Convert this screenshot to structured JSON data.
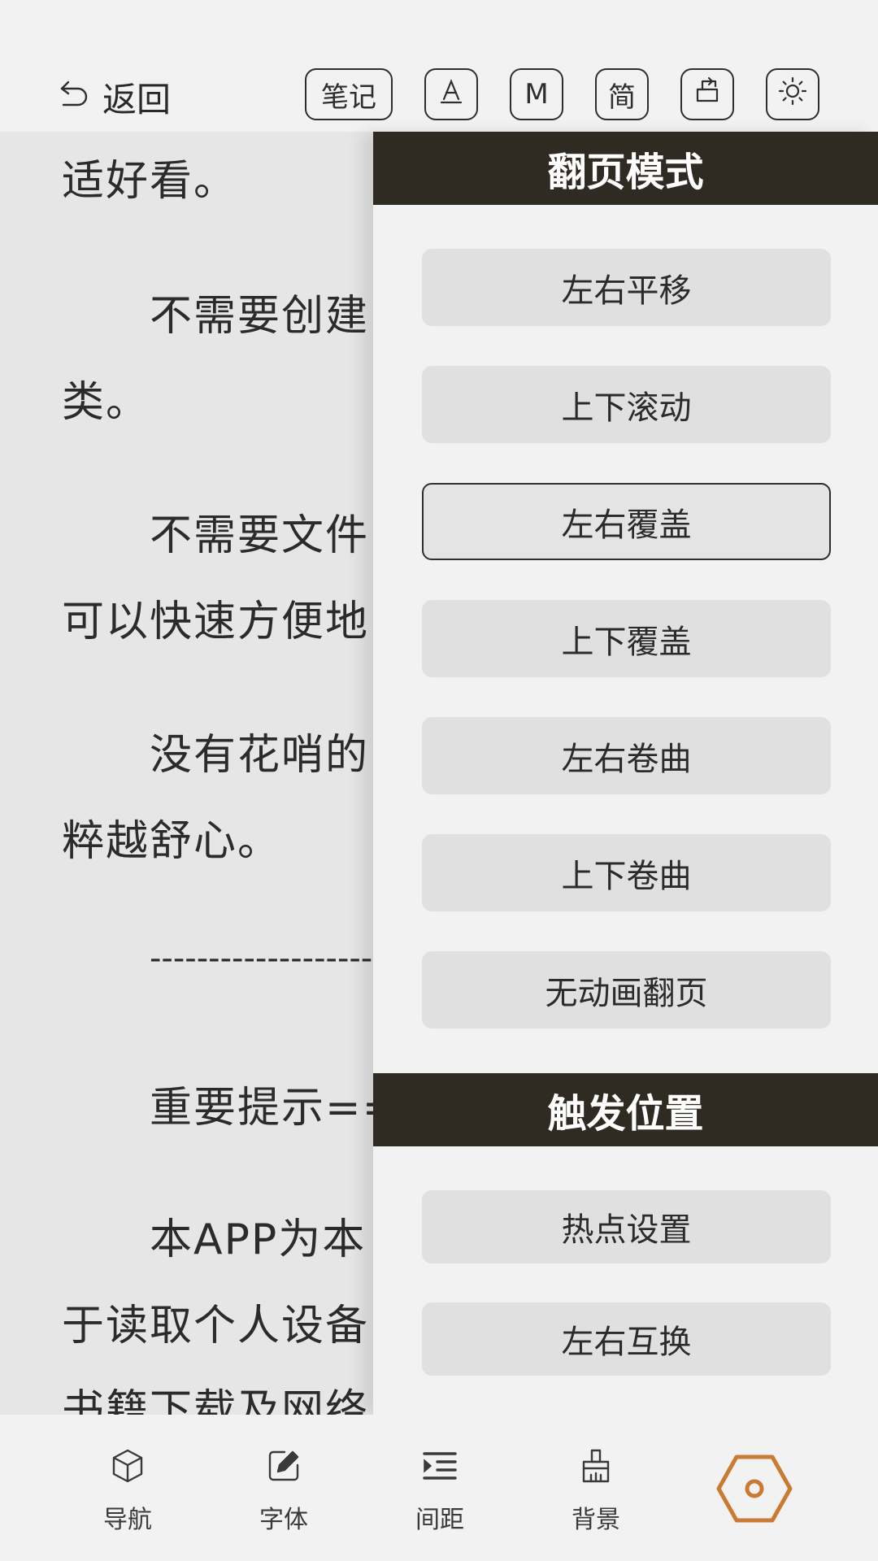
{
  "header": {
    "back_label": "返回",
    "buttons": [
      {
        "name": "note-button",
        "label": "笔记"
      },
      {
        "name": "font-style-button",
        "label": ""
      },
      {
        "name": "m-button",
        "label": "M"
      },
      {
        "name": "simplified-button",
        "label": "简"
      },
      {
        "name": "export-button",
        "label": ""
      },
      {
        "name": "brightness-button",
        "label": ""
      }
    ]
  },
  "reader": {
    "lines": [
      "适好看。",
      "不需要创建",
      "类。",
      "不需要文件",
      "可以快速方便地",
      "没有花哨的",
      "粹越舒心。",
      "-------------------",
      "重要提示==",
      "本APP为本",
      "于读取个人设备",
      "书籍下载及网络"
    ]
  },
  "panel": {
    "page_mode_title": "翻页模式",
    "page_modes": [
      "左右平移",
      "上下滚动",
      "左右覆盖",
      "上下覆盖",
      "左右卷曲",
      "上下卷曲",
      "无动画翻页"
    ],
    "selected_mode": "左右覆盖",
    "trigger_title": "触发位置",
    "trigger_options": [
      "热点设置",
      "左右互换"
    ]
  },
  "bottom_nav": {
    "tabs": [
      "导航",
      "字体",
      "间距",
      "背景"
    ]
  },
  "colors": {
    "section_header_bg": "#2f2b22",
    "accent": "#c97a33",
    "panel_bg": "#f2f2f2",
    "option_bg": "#e0e0e0"
  }
}
